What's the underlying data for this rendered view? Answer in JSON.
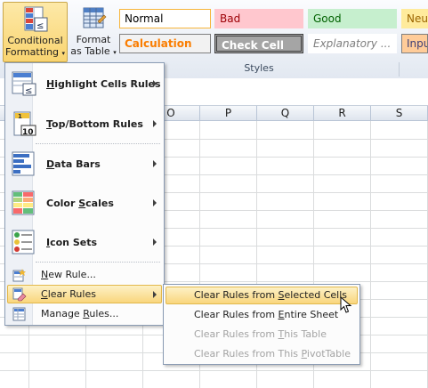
{
  "ribbon": {
    "conditional_formatting": {
      "line1": "Conditional",
      "line2": "Formatting"
    },
    "format_as_table": {
      "line1": "Format",
      "line2": "as Table"
    },
    "styles_group_label": "Styles",
    "styles": [
      {
        "label": "Normal",
        "bg": "#ffffff",
        "fg": "#000000",
        "border": "#f7b53b"
      },
      {
        "label": "Bad",
        "bg": "#ffc7ce",
        "fg": "#9c0006",
        "border": "#ffc7ce"
      },
      {
        "label": "Good",
        "bg": "#c6efce",
        "fg": "#006100",
        "border": "#c6efce"
      },
      {
        "label": "Neu",
        "bg": "#ffeb9c",
        "fg": "#9c6500",
        "border": "#ffeb9c"
      },
      {
        "label": "Calculation",
        "bg": "#f2f2f2",
        "fg": "#fa7d00",
        "border": "#7f7f7f"
      },
      {
        "label": "Check Cell",
        "bg": "#a5a5a5",
        "fg": "#ffffff",
        "border": "#3f3f3f"
      },
      {
        "label": "Explanatory ...",
        "bg": "#ffffff",
        "fg": "#7f7f7f",
        "border": "#ffffff"
      },
      {
        "label": "Inpu",
        "bg": "#ffcc99",
        "fg": "#3f3f76",
        "border": "#7f7f7f"
      }
    ]
  },
  "sheet": {
    "columns": [
      "O",
      "P",
      "Q",
      "R",
      "S"
    ]
  },
  "menu": {
    "items": [
      {
        "pre": "",
        "u": "H",
        "post": "ighlight Cells Rules",
        "icon": "highlight-cells-icon"
      },
      {
        "pre": "",
        "u": "T",
        "post": "op/Bottom Rules",
        "icon": "top-bottom-icon"
      },
      {
        "pre": "",
        "u": "D",
        "post": "ata Bars",
        "icon": "data-bars-icon"
      },
      {
        "pre": "Color ",
        "u": "S",
        "post": "cales",
        "icon": "color-scales-icon"
      },
      {
        "pre": "",
        "u": "I",
        "post": "con Sets",
        "icon": "icon-sets-icon"
      },
      {
        "pre": "",
        "u": "N",
        "post": "ew Rule...",
        "icon": "new-rule-icon"
      },
      {
        "pre": "",
        "u": "C",
        "post": "lear Rules",
        "icon": "clear-rules-icon"
      },
      {
        "pre": "Manage ",
        "u": "R",
        "post": "ules...",
        "icon": "manage-rules-icon"
      }
    ]
  },
  "submenu": {
    "items": [
      {
        "pre": "Clear Rules from ",
        "u": "S",
        "post": "elected Cells",
        "disabled": false
      },
      {
        "pre": "Clear Rules from ",
        "u": "E",
        "post": "ntire Sheet",
        "disabled": false
      },
      {
        "pre": "Clear Rules from ",
        "u": "T",
        "post": "his Table",
        "disabled": true
      },
      {
        "pre": "Clear Rules from This ",
        "u": "P",
        "post": "ivotTable",
        "disabled": true
      }
    ]
  }
}
